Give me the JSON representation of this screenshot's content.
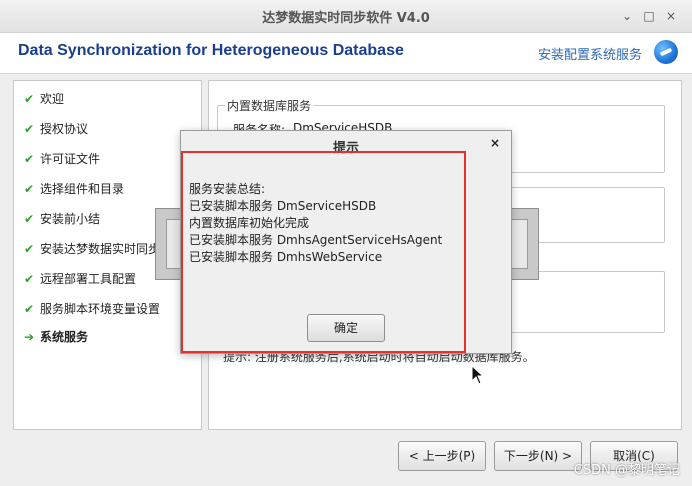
{
  "window": {
    "title": "达梦数据实时同步软件  V4.0",
    "controls": [
      "⌄",
      "□",
      "×"
    ]
  },
  "header": {
    "left_title": "Data Synchronization for Heterogeneous Database",
    "right_title": "安装配置系统服务"
  },
  "steps": [
    {
      "label": "欢迎",
      "status": "done"
    },
    {
      "label": "授权协议",
      "status": "done"
    },
    {
      "label": "许可证文件",
      "status": "done"
    },
    {
      "label": "选择组件和目录",
      "status": "done"
    },
    {
      "label": "安装前小结",
      "status": "done"
    },
    {
      "label": "安装达梦数据实时同步软",
      "status": "done"
    },
    {
      "label": "远程部署工具配置",
      "status": "done"
    },
    {
      "label": "服务脚本环境变量设置",
      "status": "done"
    },
    {
      "label": "系统服务",
      "status": "current"
    }
  ],
  "main": {
    "group1_legend": "内置数据库服务",
    "service_name_label": "服务名称:",
    "service_name_value": "DmServiceHSDB",
    "bottom_note": "提示:  注册系统服务后,系统启动时将自动启动数据库服务。"
  },
  "modal": {
    "title": "提示",
    "close": "×",
    "lines": [
      "服务安装总结:",
      "已安装脚本服务  DmServiceHSDB",
      "内置数据库初始化完成",
      "已安装脚本服务  DmhsAgentServiceHsAgent",
      "已安装脚本服务  DmhsWebService"
    ],
    "ok_label": "确定"
  },
  "buttons": {
    "prev": "< 上一步(P)",
    "next": "下一步(N) >",
    "cancel": "取消(C)"
  },
  "watermark": "CSDN @黎明笔记",
  "colors": {
    "header_blue": "#1b3f8f",
    "accent_blue": "#2e6ab6",
    "check_green": "#2aa12a",
    "highlight_red": "#e53030"
  }
}
